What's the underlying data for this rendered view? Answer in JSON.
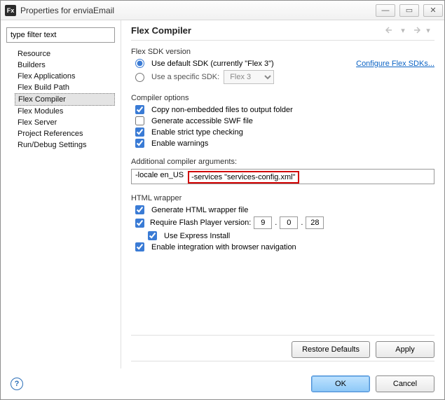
{
  "window": {
    "title": "Properties for enviaEmail",
    "app_icon": "Fx"
  },
  "sidebar": {
    "filter_value": "type filter text",
    "items": [
      "Resource",
      "Builders",
      "Flex Applications",
      "Flex Build Path",
      "Flex Compiler",
      "Flex Modules",
      "Flex Server",
      "Project References",
      "Run/Debug Settings"
    ],
    "selected_index": 4
  },
  "header": {
    "title": "Flex Compiler"
  },
  "sdk": {
    "group_title": "Flex SDK version",
    "default_label": "Use default SDK (currently \"Flex 3\")",
    "specific_label": "Use a specific SDK:",
    "specific_select": "Flex 3",
    "configure_link": "Configure Flex SDKs...",
    "selected": "default"
  },
  "compiler_opts": {
    "group_title": "Compiler options",
    "copy_label": "Copy non-embedded files to output folder",
    "accessible_label": "Generate accessible SWF file",
    "strict_label": "Enable strict type checking",
    "warnings_label": "Enable warnings",
    "copy_checked": true,
    "accessible_checked": false,
    "strict_checked": true,
    "warnings_checked": true
  },
  "arguments": {
    "label": "Additional compiler arguments:",
    "prefix": "-locale en_US",
    "highlighted": "-services \"services-config.xml\""
  },
  "html_wrapper": {
    "group_title": "HTML wrapper",
    "generate_label": "Generate HTML wrapper file",
    "require_label": "Require Flash Player version:",
    "express_label": "Use Express Install",
    "browser_nav_label": "Enable integration with browser navigation",
    "major": "9",
    "minor": "0",
    "rev": "28",
    "generate_checked": true,
    "require_checked": true,
    "express_checked": true,
    "browser_nav_checked": true,
    "dot": "."
  },
  "buttons": {
    "restore": "Restore Defaults",
    "apply": "Apply",
    "ok": "OK",
    "cancel": "Cancel"
  }
}
